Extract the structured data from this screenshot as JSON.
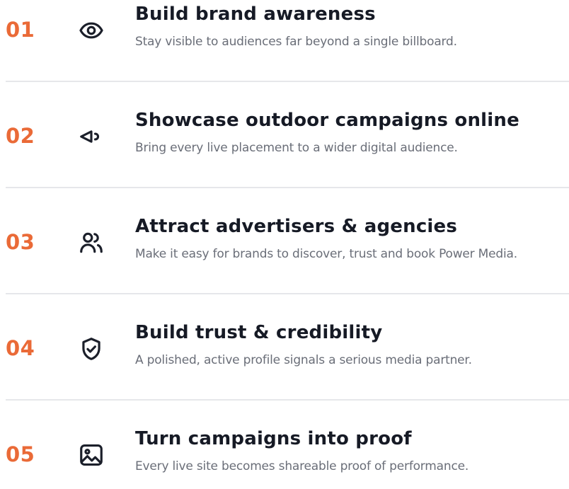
{
  "items": [
    {
      "number": "01",
      "icon": "eye-icon",
      "title": "Build brand awareness",
      "description": "Stay visible to audiences far beyond a single billboard."
    },
    {
      "number": "02",
      "icon": "megaphone-icon",
      "title": "Showcase outdoor campaigns online",
      "description": "Bring every live placement to a wider digital audience."
    },
    {
      "number": "03",
      "icon": "users-icon",
      "title": "Attract advertisers & agencies",
      "description": "Make it easy for brands to discover, trust and book Power Media."
    },
    {
      "number": "04",
      "icon": "shield-check-icon",
      "title": "Build trust & credibility",
      "description": "A polished, active profile signals a serious media partner."
    },
    {
      "number": "05",
      "icon": "image-icon",
      "title": "Turn campaigns into proof",
      "description": "Every live site becomes shareable proof of performance."
    }
  ],
  "colors": {
    "accent": "#ea6a37",
    "title": "#161a25",
    "description": "#6a6e78",
    "divider": "#e6e7ea"
  }
}
